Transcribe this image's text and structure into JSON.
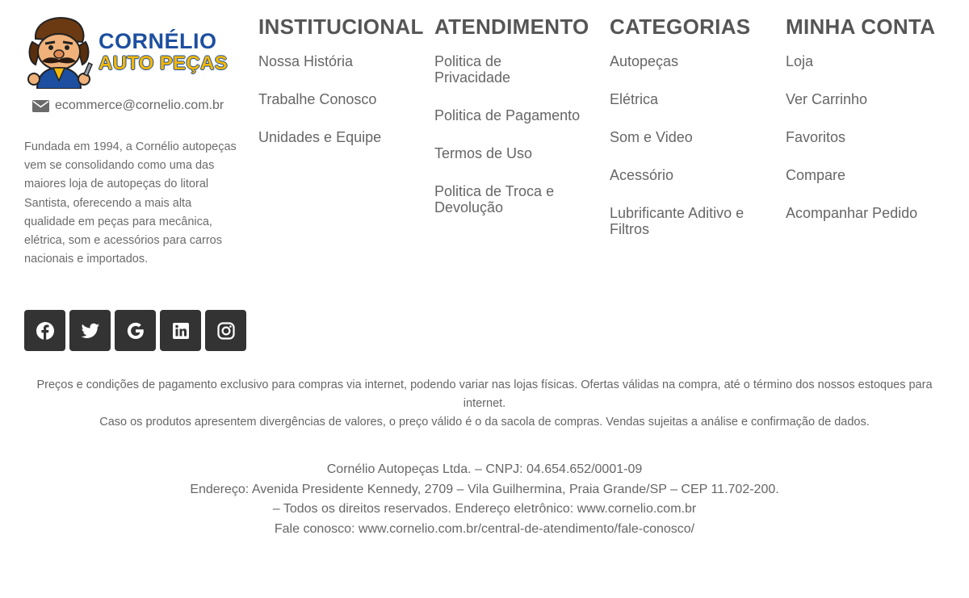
{
  "brand": {
    "logo_line1": "CORNÉLIO",
    "logo_line2": "AUTO PEÇAS",
    "email": "ecommerce@cornelio.com.br",
    "about": "Fundada em 1994, a Cornélio autopeças vem se consolidando como uma das maiores loja de autopeças do litoral Santista, oferecendo a mais alta qualidade em peças para mecânica, elétrica, som e acessórios para carros nacionais e importados."
  },
  "social": [
    {
      "icon": "facebook-icon"
    },
    {
      "icon": "twitter-icon"
    },
    {
      "icon": "google-icon"
    },
    {
      "icon": "linkedin-icon"
    },
    {
      "icon": "instagram-icon"
    }
  ],
  "columns": [
    {
      "title": "INSTITUCIONAL",
      "items": [
        "Nossa História",
        "Trabalhe Conosco",
        "Unidades e Equipe"
      ]
    },
    {
      "title": "ATENDIMENTO",
      "items": [
        "Politica de Privacidade",
        "Politica de Pagamento",
        "Termos de Uso",
        "Politica de Troca e Devolução"
      ]
    },
    {
      "title": "CATEGORIAS",
      "items": [
        "Autopeças",
        "Elétrica",
        "Som e Video",
        "Acessório",
        "Lubrificante Aditivo e Filtros"
      ]
    },
    {
      "title": "MINHA CONTA",
      "items": [
        "Loja",
        "Ver Carrinho",
        "Favoritos",
        "Compare",
        "Acompanhar Pedido"
      ]
    }
  ],
  "disclaimer": {
    "line1": "Preços e condições de pagamento exclusivo para compras via internet, podendo variar nas lojas físicas. Ofertas válidas na compra, até o término dos nossos estoques para internet.",
    "line2": "Caso os produtos apresentem divergências de valores, o preço válido é o da sacola de compras. Vendas sujeitas a análise e confirmação de dados."
  },
  "legal": {
    "company": "Cornélio Autopeças Ltda. – CNPJ: 04.654.652/0001-09",
    "address": "Endereço: Avenida Presidente Kennedy, 2709 – Vila Guilhermina, Praia Grande/SP – CEP 11.702-200.",
    "rights": "– Todos os direitos reservados. Endereço eletrônico: www.cornelio.com.br",
    "contact": "Fale conosco: www.cornelio.com.br/central-de-atendimento/fale-conosco/"
  },
  "colors": {
    "logo_blue": "#1d4fa0",
    "logo_yellow": "#f2b705",
    "social_bg": "#333333",
    "text": "#666666"
  }
}
